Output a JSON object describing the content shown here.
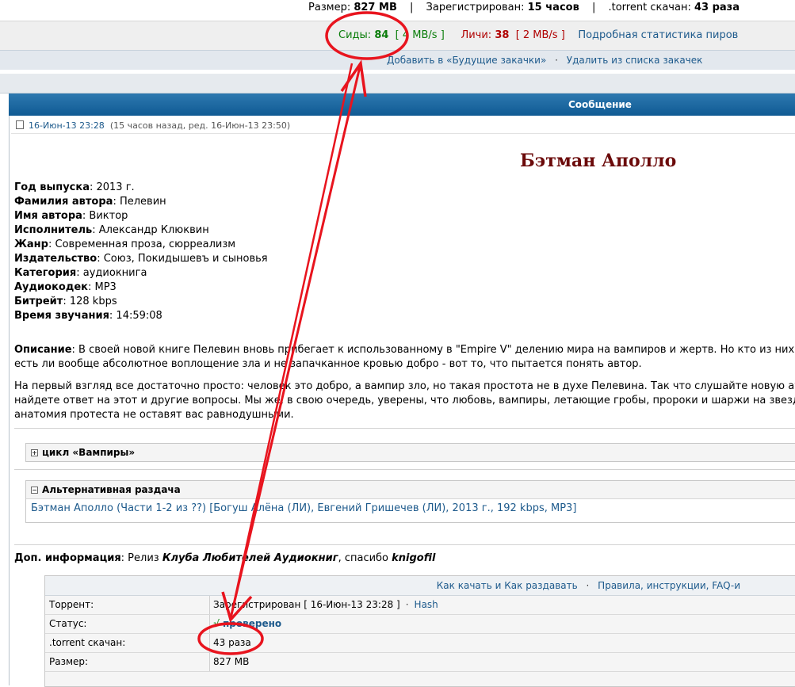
{
  "top_stats": {
    "size_label": "Размер:",
    "size_value": "827 MB",
    "registered_label": "Зарегистрирован:",
    "registered_value": "15 часов",
    "downloaded_label": ".torrent скачан:",
    "downloaded_value": "43 раза",
    "separator": "|"
  },
  "peers": {
    "seeds_label": "Сиды:",
    "seeds_value": "84",
    "seeds_speed": "[  4 MB/s  ]",
    "leeches_label": "Личи:",
    "leeches_value": "38",
    "leeches_speed": "[  2 MB/s  ]",
    "stats_link": "Подробная статистика пиров"
  },
  "future": {
    "add_link": "Добавить в «Будущие закачки»",
    "remove_link": "Удалить из списка закачек",
    "dot": "·"
  },
  "post": {
    "header": "Сообщение",
    "date_link": "16-Июн-13 23:28",
    "date_note": "(15 часов назад, ред. 16-Июн-13 23:50)",
    "title": "Бэтман Аполло",
    "fields": [
      {
        "label": "Год выпуска",
        "value": ": 2013 г."
      },
      {
        "label": "Фамилия автора",
        "value": ": Пелевин"
      },
      {
        "label": "Имя автора",
        "value": ": Виктор"
      },
      {
        "label": "Исполнитель",
        "value": ": Александр Клюквин"
      },
      {
        "label": "Жанр",
        "value": ": Современная проза, сюрреализм"
      },
      {
        "label": "Издательство",
        "value": ": Союз, Покидышевъ и сыновья"
      },
      {
        "label": "Категория",
        "value": ": аудиокнига"
      },
      {
        "label": "Аудиокодек",
        "value": ": MP3"
      },
      {
        "label": "Битрейт",
        "value": ": 128 kbps"
      },
      {
        "label": "Время звучания",
        "value": ": 14:59:08"
      }
    ],
    "desc_label": "Описание",
    "desc_line1": ": В своей новой книге Пелевин вновь прибегает к использованному в \"Empire V\" делению мира на вампиров и жертв. Но кто из них олицетв",
    "desc_line2": "есть ли вообще абсолютное воплощение зла и не запачканное кровью добро - вот то, что пытается понять автор.",
    "desc_p2_line1": "На первый взгляд все достаточно просто: человек это добро, а вампир зло, но такая простота не в духе Пелевина. Так что слушайте новую аудиокни",
    "desc_p2_line2": "найдете ответ на этот и другие вопросы. Мы же, в свою очередь, уверены, что любовь, вампиры, летающие гробы, пророки и шаржи на звезд эстрад",
    "desc_p2_line3": "анатомия протеста не оставят вас равнодушными.",
    "spoiler1_title": "цикл «Вампиры»",
    "spoiler1_icon": "+",
    "spoiler2_title": "Альтернативная раздача",
    "spoiler2_icon": "−",
    "spoiler2_link": "Бэтман Аполло (Части 1-2 из ??) [Богуш Алёна (ЛИ), Евгений Гришечев (ЛИ), 2013 г., 192 kbps, MP3]",
    "extra_label": "Доп. информация",
    "extra_text1": ": Релиз ",
    "extra_club": "Клуба Любителей Аудиокниг",
    "extra_text2": ", спасибо ",
    "extra_user": "knigofil"
  },
  "torrent_table": {
    "how_link": "Как качать и Как раздавать",
    "rules_link": "Правила, инструкции, FAQ-и",
    "rows": [
      {
        "key": "Торрент:",
        "value": "Зарегистрирован  [ 16-Июн-13 23:28 ]",
        "extra": "Hash"
      },
      {
        "key": "Статус:",
        "value": "проверено"
      },
      {
        "key": ".torrent скачан:",
        "value": "43 раза"
      },
      {
        "key": "Размер:",
        "value": "827 MB"
      }
    ]
  },
  "colors": {
    "annotation": "#e8141e",
    "header_bg": "#1a679f",
    "title": "#6b0a0a",
    "seeds": "#0a7d0a",
    "leeches": "#b00000",
    "link": "#1d5a8c"
  }
}
